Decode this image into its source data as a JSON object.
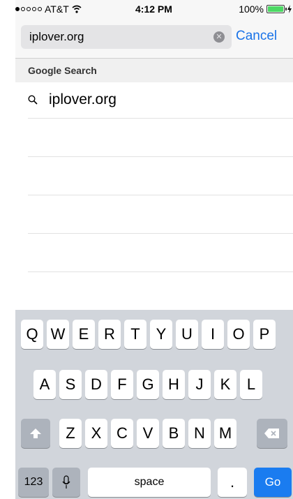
{
  "status_bar": {
    "carrier": "AT&T",
    "time": "4:12 PM",
    "battery": "100%"
  },
  "search": {
    "value": "iplover.org",
    "cancel_label": "Cancel"
  },
  "section": {
    "title": "Google Search"
  },
  "results": [
    {
      "label": "iplover.org"
    }
  ],
  "keyboard": {
    "row1": [
      "Q",
      "W",
      "E",
      "R",
      "T",
      "Y",
      "U",
      "I",
      "O",
      "P"
    ],
    "row2": [
      "A",
      "S",
      "D",
      "F",
      "G",
      "H",
      "J",
      "K",
      "L"
    ],
    "row3": [
      "Z",
      "X",
      "C",
      "V",
      "B",
      "N",
      "M"
    ],
    "numbers": "123",
    "space": "space",
    "period": ".",
    "go": "Go"
  }
}
